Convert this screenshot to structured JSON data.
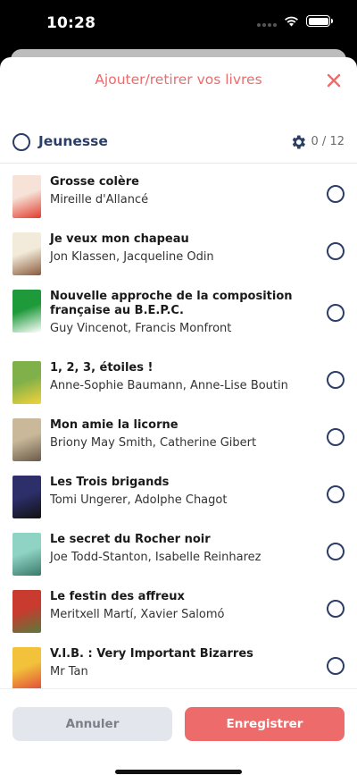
{
  "status_bar": {
    "time": "10:28"
  },
  "sheet": {
    "title": "Ajouter/retirer vos livres",
    "close_icon": "close-icon"
  },
  "group": {
    "name": "Jeunesse",
    "count": "0 / 12",
    "settings_icon": "gear-icon"
  },
  "books": [
    {
      "title": "Grosse colère",
      "authors": "Mireille d'Allancé",
      "cover_colors": [
        "#f6e2d6",
        "#e23b2e"
      ]
    },
    {
      "title": "Je veux mon chapeau",
      "authors": "Jon Klassen, Jacqueline Odin",
      "cover_colors": [
        "#f2ebd9",
        "#8a5a3a"
      ]
    },
    {
      "title": "Nouvelle approche de la composition française au B.E.P.C.",
      "authors": "Guy Vincenot, Francis Monfront",
      "cover_colors": [
        "#1e9a3a",
        "#ffffff"
      ]
    },
    {
      "title": "1, 2, 3, étoiles !",
      "authors": "Anne-Sophie Baumann, Anne-Lise Boutin",
      "cover_colors": [
        "#7fb04a",
        "#f5d23a"
      ]
    },
    {
      "title": "Mon amie la licorne",
      "authors": "Briony May Smith, Catherine Gibert",
      "cover_colors": [
        "#c9b99a",
        "#6b5a4a"
      ]
    },
    {
      "title": "Les Trois brigands",
      "authors": "Tomi Ungerer, Adolphe Chagot",
      "cover_colors": [
        "#2d2f6b",
        "#111111"
      ]
    },
    {
      "title": "Le secret du Rocher noir",
      "authors": "Joe Todd-Stanton, Isabelle Reinharez",
      "cover_colors": [
        "#8fd3c4",
        "#3a7a6a"
      ]
    },
    {
      "title": "Le festin des affreux",
      "authors": "Meritxell Martí, Xavier Salomó",
      "cover_colors": [
        "#c93a2f",
        "#5a7a3a"
      ]
    },
    {
      "title": "V.I.B. : Very Important Bizarres",
      "authors": "Mr Tan",
      "cover_colors": [
        "#f2c23a",
        "#e24a3a"
      ]
    }
  ],
  "footer": {
    "cancel_label": "Annuler",
    "save_label": "Enregistrer"
  },
  "colors": {
    "accent": "#ee6b6b",
    "navy": "#2c3e66",
    "cancel_bg": "#e3e6ec"
  }
}
